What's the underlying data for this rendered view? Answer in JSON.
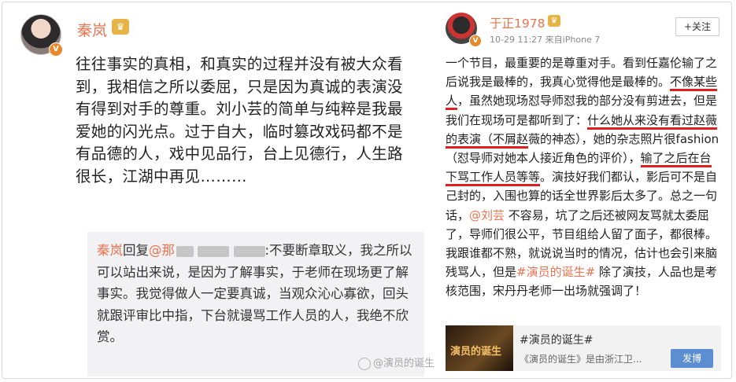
{
  "left": {
    "name": "秦岚",
    "post": "往往事实的真相，和真实的过程并没有被大众看到，我相信之所以委屈，只是因为真诚的表演没有得到对手的尊重。刘小芸的简单与纯粹是我最爱她的闪光点。过于自大，临时篡改戏码都不是有品德的人，戏中见品行，台上见德行，人生路很长，江湖中再见………",
    "reply": {
      "user": "秦岚",
      "action": "回复",
      "target": "@那",
      "text": ":不要断章取义，我之所以可以站出来说，是因为了解事实，于老师在现场更了解事实。我觉得做人一定要真诚，当观众沁心寡欲，回头就跟评审比中指，下台就谩骂工作人员的人，我绝不欣赏。"
    }
  },
  "right": {
    "name": "于正1978",
    "time": "10-29 11:27",
    "source": "来自iPhone 7",
    "follow": "+关注",
    "p1": "一个节目，最重要的是尊重对手。看到任嘉伦输了之后说我是最棒的，我真心觉得他是最棒的。",
    "h1": "不像某些人",
    "p2": "，虽然她现场怼导师怼我的部分没有剪进去，但是我们在现场可是都听到了：",
    "h2": "什么她从来没有看过赵薇的表演（不屑赵",
    "p3": "薇的神态）",
    "p4": "，她的杂志照片很fashion（怼导师对她本人接近角色的评价），",
    "h3": "输了之后在台下",
    "h4": "骂工作人员等等",
    "p5": "。演技好我们都认，影后可不是自己封的，入围也算的话全世界影后太多了。总之一句话，",
    "mention": "@刘芸",
    "p6": " 不容易，坑了之后还被网友骂就太委屈了，导师们很公平，节目组给人留了面子，都很棒。我跟谁都不熟，就说说当时的情况，估计也会引来脑残骂人，但是",
    "hashtag": "#演员的诞生#",
    "p7": " 除了演技，人品也是考核范围，宋丹丹老师一出场就强调了！",
    "card": {
      "title": "#演员的诞生#",
      "desc": "《演员的诞生》是由浙江卫...",
      "button": "发博",
      "thumb_text": "演员的诞生"
    }
  },
  "watermark": "@演员的诞生"
}
